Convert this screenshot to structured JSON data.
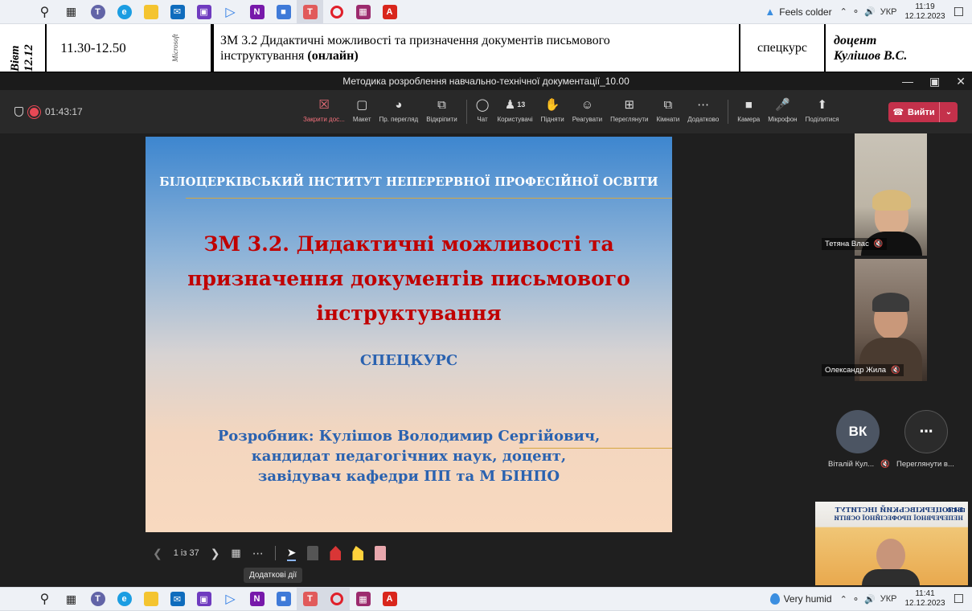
{
  "taskbar_top": {
    "weather": "Feels colder",
    "lang": "УКР",
    "time": "11:19",
    "date": "12.12.2023"
  },
  "taskbar_bottom": {
    "weather": "Very humid",
    "lang": "УКР",
    "time": "11:41",
    "date": "12.12.2023"
  },
  "schedule": {
    "day": "Вівт 12.12",
    "time": "11.30-12.50",
    "platform": "Microsoft",
    "topic_a": "ЗМ 3.2 Дидактичні можливості та призначення документів письмового",
    "topic_b": "інструктування",
    "topic_c": "(онлайн)",
    "type": "спецкурс",
    "rank": "доцент",
    "teacher": "Кулішов В.С."
  },
  "window": {
    "title": "Методика розроблення навчально-технічної документації_10.00"
  },
  "meeting": {
    "duration": "01:43:17",
    "participants_count": "13",
    "tools": [
      {
        "label": "Закрити дос...",
        "icon": "close-share-icon"
      },
      {
        "label": "Макет",
        "icon": "layout-icon"
      },
      {
        "label": "Пр. перегляд",
        "icon": "eye-icon"
      },
      {
        "label": "Відкріпити",
        "icon": "popout-icon"
      },
      {
        "label": "Чат",
        "icon": "chat-icon"
      },
      {
        "label": "Користувачі",
        "icon": "people-icon"
      },
      {
        "label": "Підняти",
        "icon": "hand-icon"
      },
      {
        "label": "Реагувати",
        "icon": "smile-icon"
      },
      {
        "label": "Переглянути",
        "icon": "view-icon"
      },
      {
        "label": "Кімнати",
        "icon": "rooms-icon"
      },
      {
        "label": "Додатково",
        "icon": "more-icon"
      },
      {
        "label": "Камера",
        "icon": "camera-icon"
      },
      {
        "label": "Мікрофон",
        "icon": "mic-icon"
      },
      {
        "label": "Поділитися",
        "icon": "share-icon"
      }
    ],
    "leave_label": "Вийти"
  },
  "slide": {
    "institute": "БІЛОЦЕРКІВСЬКИЙ ІНСТИТУТ НЕПЕРЕРВНОЇ ПРОФЕСІЙНОЇ ОСВІТИ",
    "title_1": "ЗМ 3.2. Дидактичні можливості та",
    "title_2": "призначення документів письмового",
    "title_3": "інструктування",
    "course": "СПЕЦКУРС",
    "author_1": "Розробник: Кулішов Володимир Сергійович,",
    "author_2": "кандидат педагогічних наук, доцент,",
    "author_3": "завідувач кафедри ПП та М БІНПО"
  },
  "slide_controls": {
    "page": "1 із 37",
    "tooltip": "Додаткові дії"
  },
  "participants": [
    {
      "name": "Тетяна Влас"
    },
    {
      "name": "Олександр Жила"
    },
    {
      "name": "Віталій Кул...",
      "initials": "ВК"
    },
    {
      "name": "Переглянути в..."
    }
  ],
  "presenter_preview": {
    "line1": "БІЛОЦЕРКІВСЬКИЙ ІНСТИТУТ",
    "line2": "НЕПЕРЕРВНОЇ ПРОФЕСІЙНОЇ ОСВІТИ",
    "logo": "БІНПО"
  }
}
